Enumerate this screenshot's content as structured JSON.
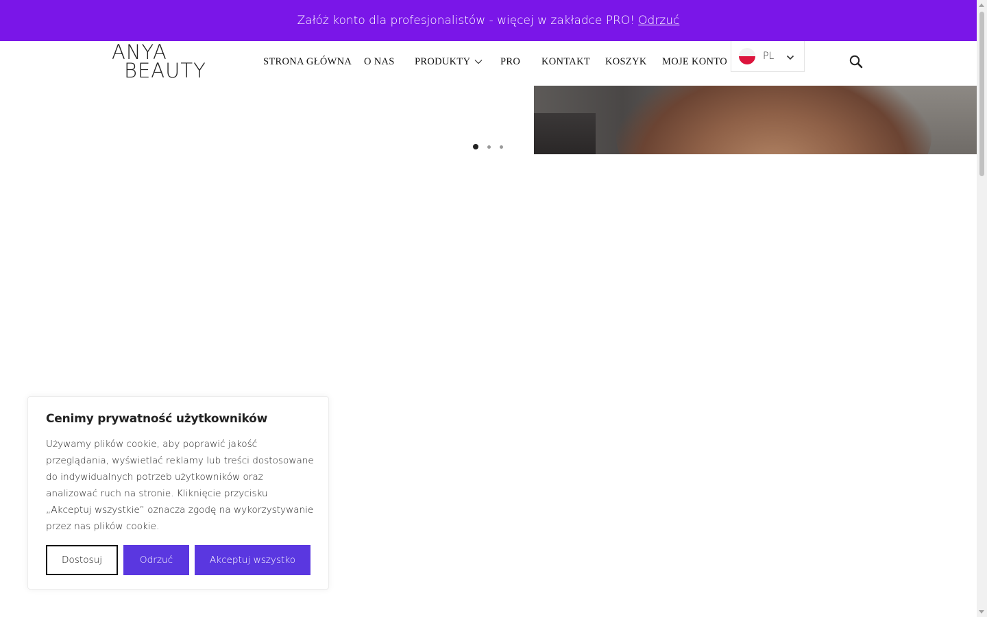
{
  "promo": {
    "text": "Załóż konto dla profesjonalistów - więcej w zakładce PRO!",
    "dismiss_label": "Odrzuć",
    "background": "#7a16e8"
  },
  "logo": {
    "line1": "ANYA",
    "line2": "BEAUTY"
  },
  "nav": {
    "items": [
      {
        "label": "STRONA GŁÓWNA"
      },
      {
        "label": "O NAS"
      },
      {
        "label": "PRODUKTY",
        "has_dropdown": true
      },
      {
        "label": "PRO"
      },
      {
        "label": "KONTAKT"
      },
      {
        "label": "KOSZYK"
      },
      {
        "label": "MOJE KONTO"
      }
    ]
  },
  "language": {
    "code": "PL",
    "flag": "poland-flag-icon"
  },
  "search": {
    "icon": "search-icon"
  },
  "slider": {
    "total": 3,
    "active_index": 0
  },
  "cookie": {
    "title": "Cenimy prywatność użytkowników",
    "body": "Używamy plików cookie, aby poprawić jakość przeglądania, wyświetlać reklamy lub treści dostosowane do indywidualnych potrzeb użytkowników oraz analizować ruch na stronie. Kliknięcie przycisku „Akceptuj wszystkie” oznacza zgodę na wykorzystywanie przez nas plików cookie.",
    "customize_label": "Dostosuj",
    "reject_label": "Odrzuć",
    "accept_label": "Akceptuj wszystko",
    "accent": "#5a37e0"
  }
}
